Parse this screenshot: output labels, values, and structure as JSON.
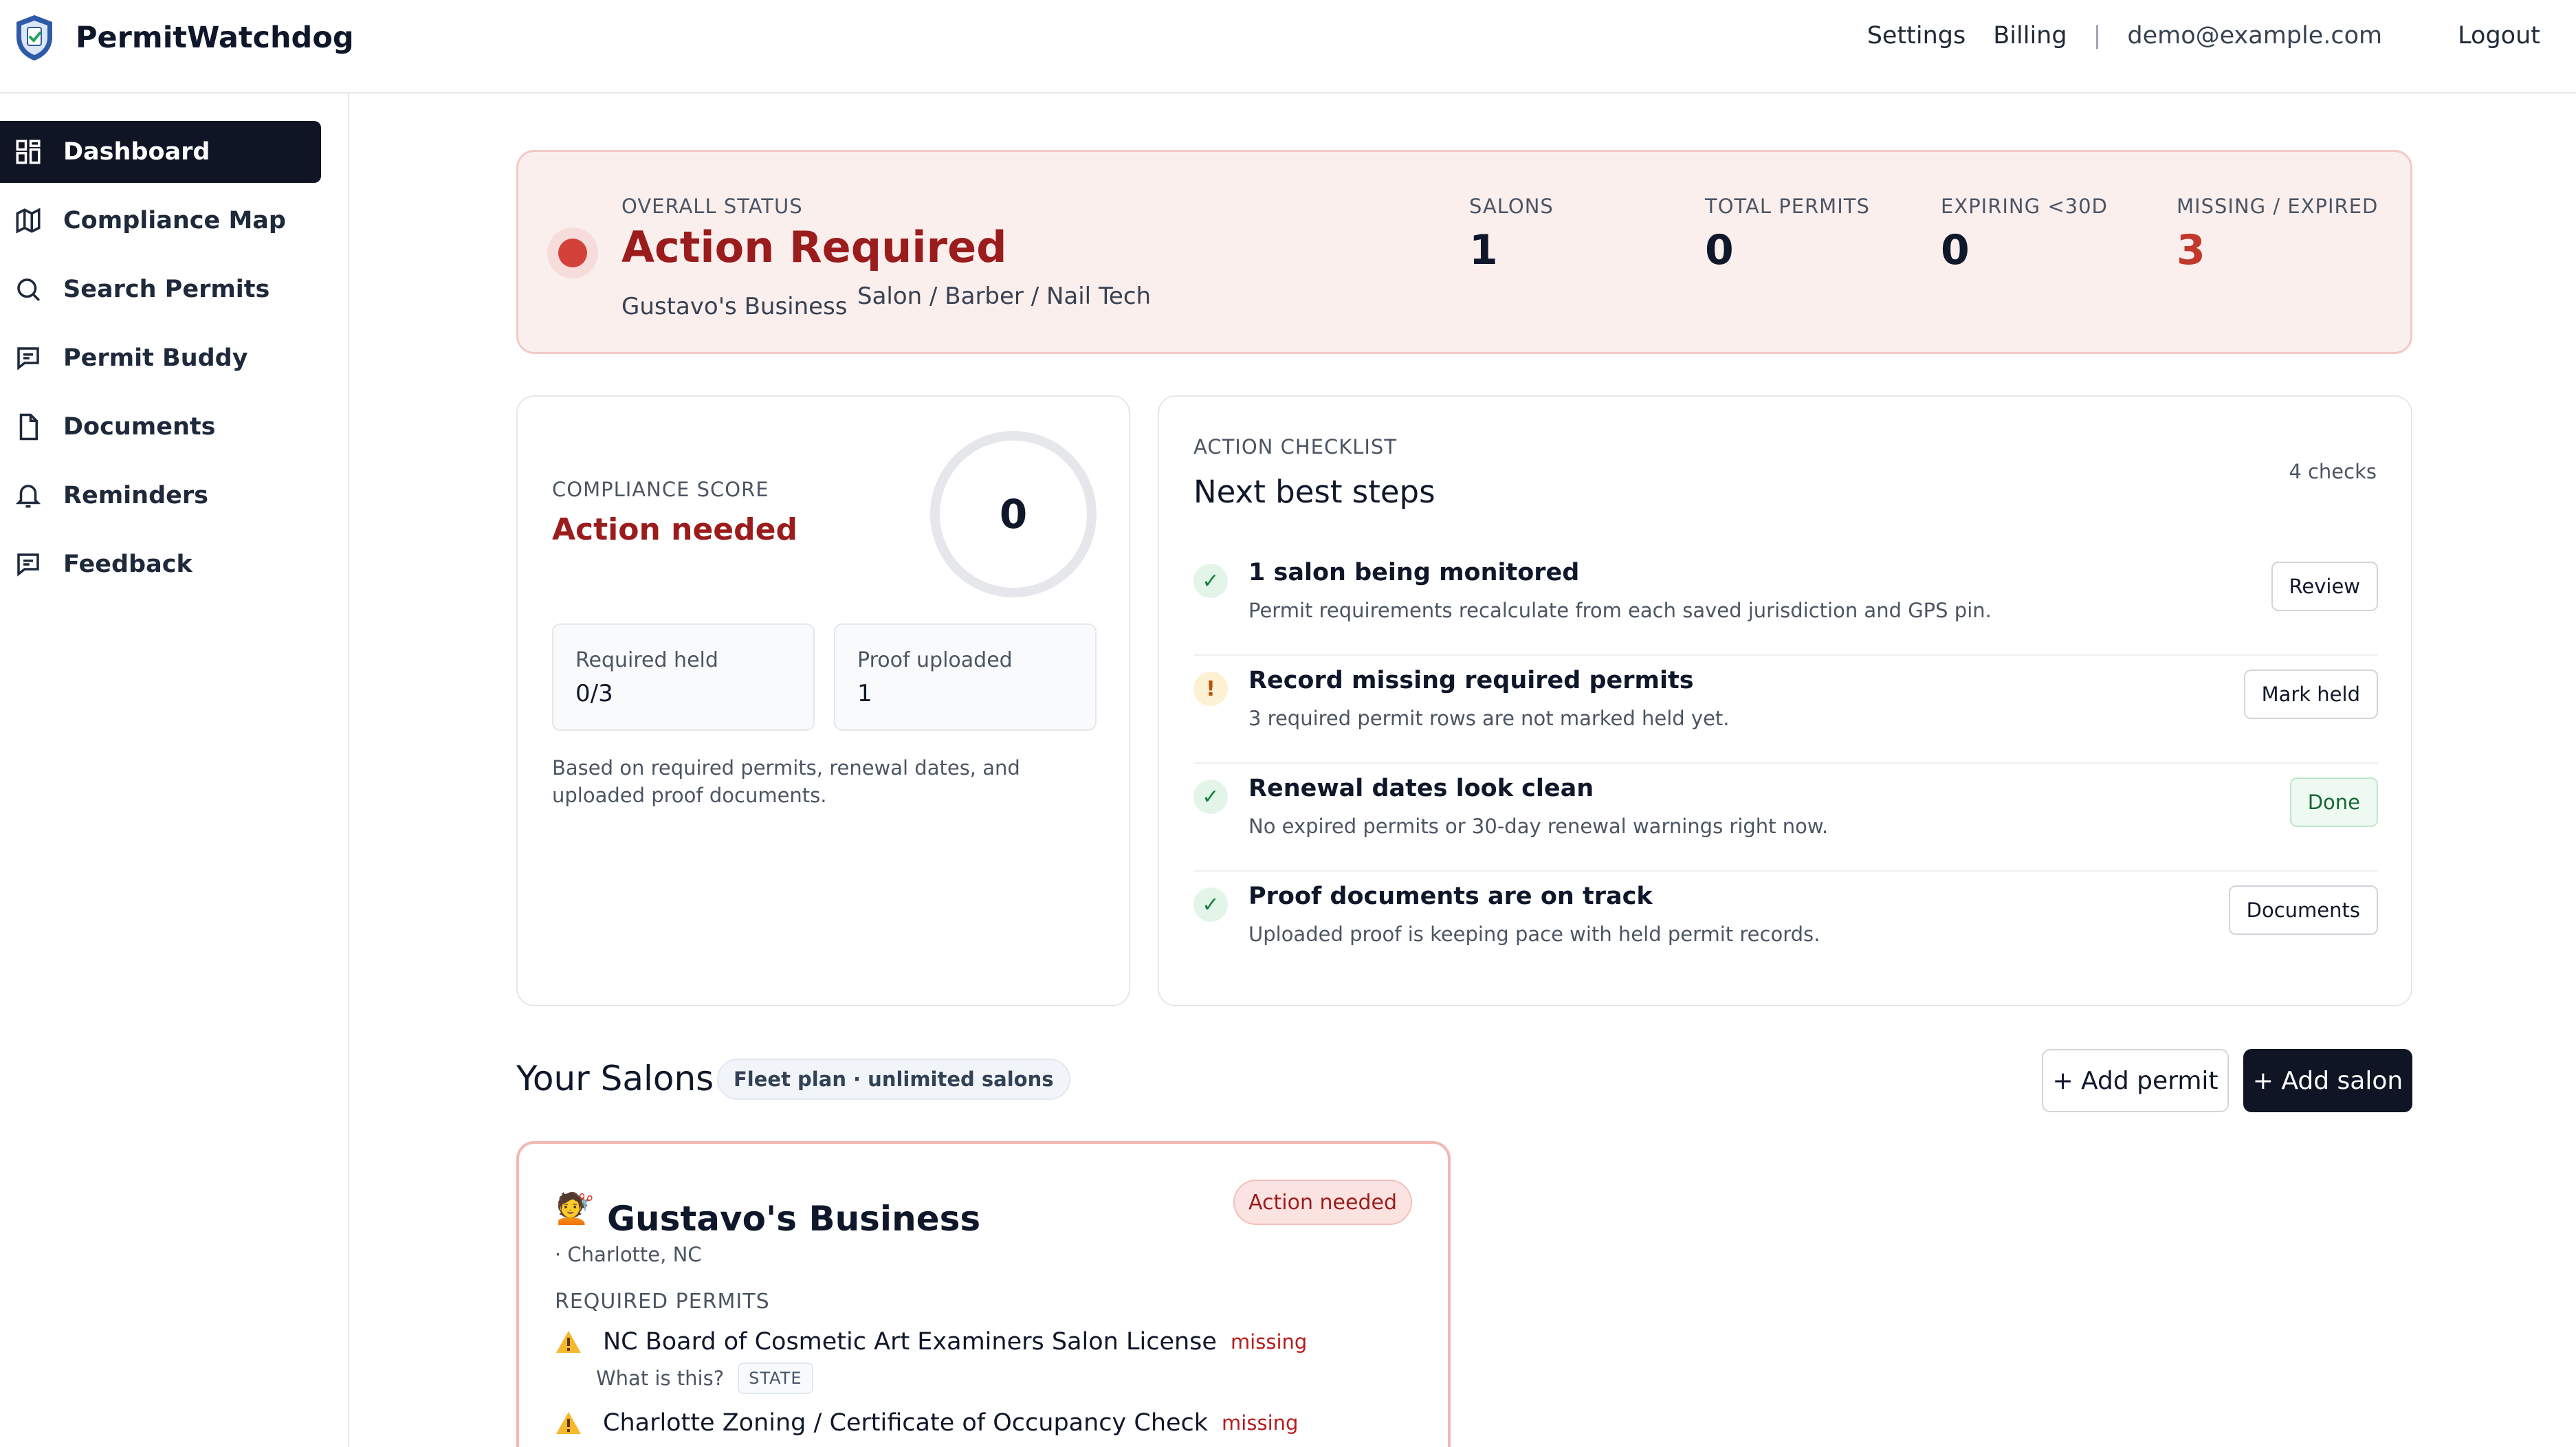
{
  "header": {
    "app_name": "PermitWatchdog",
    "nav": {
      "settings": "Settings",
      "billing": "Billing",
      "separator": "|",
      "email": "demo@example.com",
      "logout": "Logout"
    }
  },
  "sidebar": {
    "items": [
      {
        "label": "Dashboard",
        "icon": "grid-icon",
        "active": true
      },
      {
        "label": "Compliance Map",
        "icon": "map-icon"
      },
      {
        "label": "Search Permits",
        "icon": "search-icon"
      },
      {
        "label": "Permit Buddy",
        "icon": "chat-icon"
      },
      {
        "label": "Documents",
        "icon": "document-icon"
      },
      {
        "label": "Reminders",
        "icon": "bell-icon"
      },
      {
        "label": "Feedback",
        "icon": "message-icon"
      }
    ]
  },
  "overall": {
    "label": "OVERALL STATUS",
    "status": "Action Required",
    "business": "Gustavo's Business",
    "category": "Salon / Barber / Nail Tech",
    "stats": [
      {
        "label": "SALONS",
        "value": "1"
      },
      {
        "label": "TOTAL PERMITS",
        "value": "0"
      },
      {
        "label": "EXPIRING <30D",
        "value": "0"
      },
      {
        "label": "MISSING / EXPIRED",
        "value": "3"
      }
    ]
  },
  "score": {
    "label": "COMPLIANCE SCORE",
    "status": "Action needed",
    "value": "0",
    "boxes": [
      {
        "label": "Required held",
        "value": "0/3"
      },
      {
        "label": "Proof uploaded",
        "value": "1"
      }
    ],
    "note": "Based on required permits, renewal dates, and uploaded proof documents."
  },
  "checklist": {
    "label": "ACTION CHECKLIST",
    "title": "Next best steps",
    "count": "4 checks",
    "items": [
      {
        "icon": "check-icon",
        "icon_text": "✓",
        "title": "1 salon being monitored",
        "subtitle": "Permit requirements recalculate from each saved jurisdiction and GPS pin.",
        "button": "Review"
      },
      {
        "icon": "alert-icon",
        "icon_text": "!",
        "title": "Record missing required permits",
        "subtitle": "3 required permit rows are not marked held yet.",
        "button": "Mark held"
      },
      {
        "icon": "check-icon",
        "icon_text": "✓",
        "title": "Renewal dates look clean",
        "subtitle": "No expired permits or 30-day renewal warnings right now.",
        "button": "Done"
      },
      {
        "icon": "check-icon",
        "icon_text": "✓",
        "title": "Proof documents are on track",
        "subtitle": "Uploaded proof is keeping pace with held permit records.",
        "button": "Documents"
      }
    ]
  },
  "salons": {
    "title": "Your Salons",
    "plan": "Fleet plan · unlimited salons",
    "add_permit": "+ Add permit",
    "add_salon": "+ Add salon",
    "cards": [
      {
        "emoji": "💇",
        "name": "Gustavo's Business",
        "location": "· Charlotte, NC",
        "badge": "Action needed",
        "required_label": "REQUIRED PERMITS",
        "permits": [
          {
            "name": "NC Board of Cosmetic Art Examiners Salon License",
            "status": "missing"
          },
          {
            "name": "Charlotte Zoning / Certificate of Occupancy Check",
            "status": "missing"
          }
        ],
        "what_is": "What is this?",
        "tag": "STATE"
      }
    ]
  },
  "colors": {
    "accent_dark": "#0f1524",
    "danger": "#9b1c1c",
    "banner_bg": "#fbefee",
    "success": "#16803c"
  }
}
